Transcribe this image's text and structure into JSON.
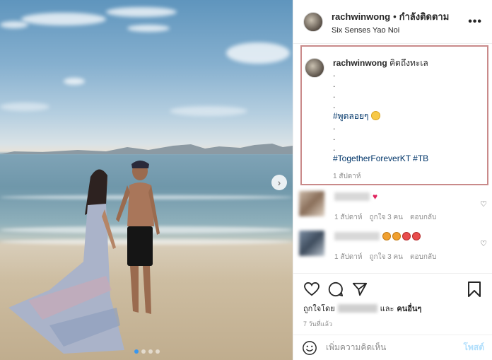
{
  "post": {
    "carousel": {
      "slide_count": 4,
      "active_index": 0
    }
  },
  "header": {
    "username": "rachwinwong",
    "separator": "•",
    "follow_status": "กำลังติดตาม",
    "location": "Six Senses Yao Noi",
    "more_icon": "more-horizontal-icon"
  },
  "caption": {
    "username": "rachwinwong",
    "text": "คิดถึงทะเล",
    "lines": [
      ".",
      ".",
      ".",
      "."
    ],
    "hashtag1": "#พูดลอยๆ",
    "lines2": [
      ".",
      ".",
      "."
    ],
    "hashtags2": "#TogetherForeverKT #TB",
    "time": "1 สัปดาห์"
  },
  "comments": [
    {
      "time": "1 สัปดาห์",
      "likes": "ถูกใจ 3 คน",
      "reply": "ตอบกลับ"
    },
    {
      "time": "1 สัปดาห์",
      "likes": "ถูกใจ 3 คน",
      "reply": "ตอบกลับ"
    }
  ],
  "actions": {
    "liked_by_prefix": "ถูกใจโดย",
    "and": "และ",
    "others": "คนอื่นๆ",
    "age": "7 วันที่แล้ว"
  },
  "comment_box": {
    "placeholder": "เพิ่มความคิดเห็น",
    "post_label": "โพสต์"
  },
  "colors": {
    "hashtag": "#003569",
    "highlight_border": "#c98a8a",
    "post_disabled": "#b2dffc",
    "carousel_active": "#3897f0"
  }
}
